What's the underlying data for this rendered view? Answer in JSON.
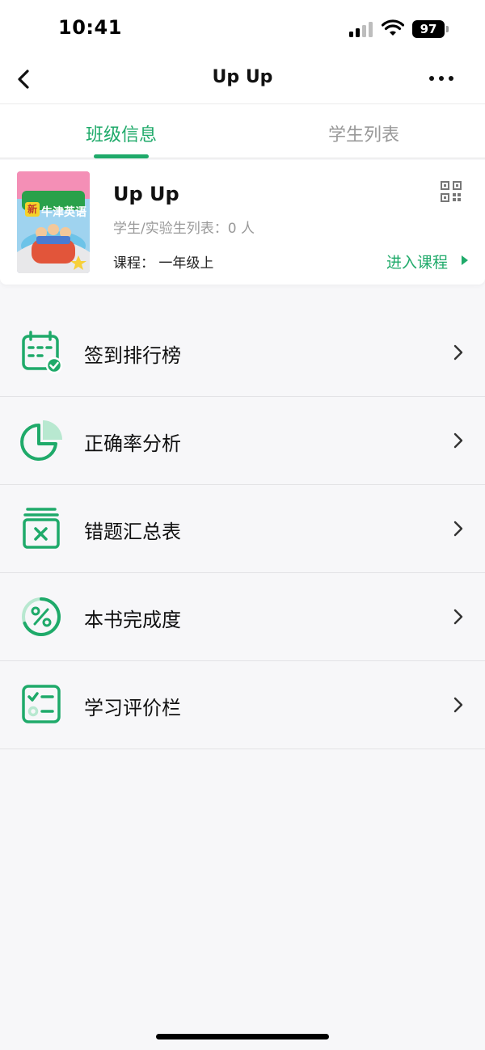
{
  "status_bar": {
    "time": "10:41",
    "battery": "97"
  },
  "nav": {
    "title": "Up Up",
    "back_icon": "chevron-left-icon",
    "more_icon": "more-dots-icon"
  },
  "tabs": [
    {
      "label": "班级信息",
      "active": true
    },
    {
      "label": "学生列表",
      "active": false
    }
  ],
  "class_card": {
    "cover_title": "牛津英语",
    "cover_badge": "新",
    "name": "Up Up",
    "student_count": "学生/实验生列表：0 人",
    "course": "课程：  一年级上",
    "enter_course": "进入课程"
  },
  "menu": [
    {
      "label": "签到排行榜",
      "icon": "calendar-check-icon"
    },
    {
      "label": "正确率分析",
      "icon": "pie-chart-icon"
    },
    {
      "label": "错题汇总表",
      "icon": "error-book-icon"
    },
    {
      "label": "本书完成度",
      "icon": "percent-progress-icon"
    },
    {
      "label": "学习评价栏",
      "icon": "checklist-icon"
    }
  ],
  "colors": {
    "accent": "#1faa6a",
    "accent_light": "#b8e8d0"
  }
}
